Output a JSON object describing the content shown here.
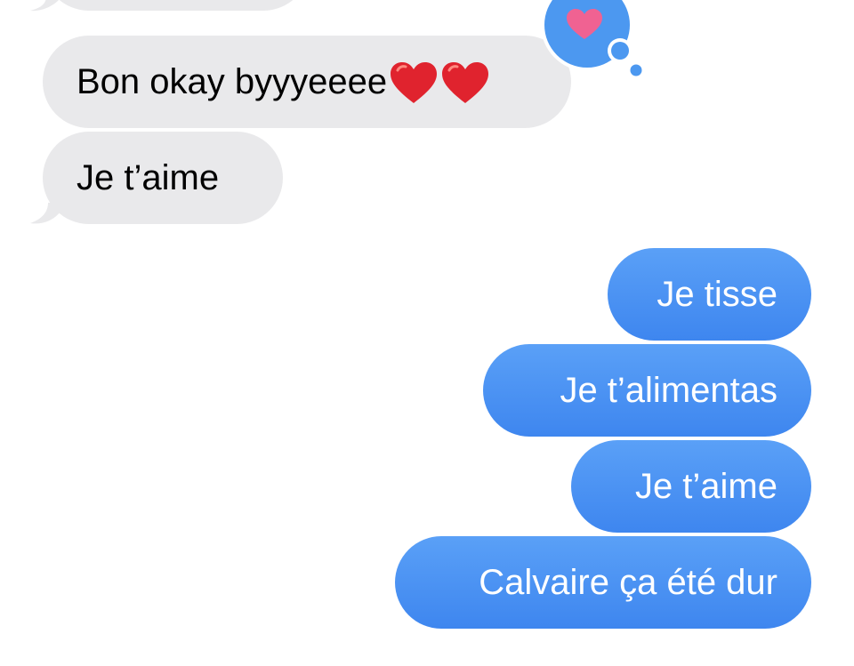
{
  "conversation": {
    "incoming": [
      {
        "text": ""
      },
      {
        "text": "Bon okay byyyeeee",
        "emoji": [
          "red-heart",
          "red-heart"
        ]
      },
      {
        "text": "Je t’aime"
      }
    ],
    "tapback": {
      "icon": "heart-icon",
      "color": "#f06292",
      "bubble_color": "#4c98f0"
    },
    "outgoing": [
      {
        "text": "Je tisse"
      },
      {
        "text": "Je t’alimentas"
      },
      {
        "text": "Je t’aime"
      },
      {
        "text": "Calvaire ça été dur"
      }
    ]
  },
  "colors": {
    "incoming_bubble": "#e9e9eb",
    "outgoing_bubble": "#3e86ef",
    "heart_emoji": "#e0232e"
  }
}
